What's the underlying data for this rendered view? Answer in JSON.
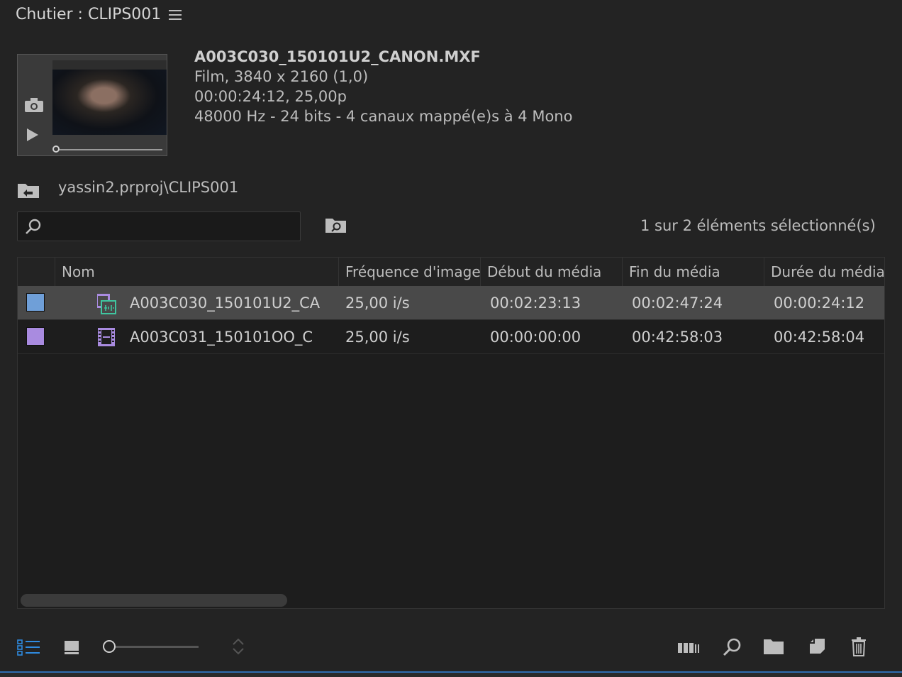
{
  "panel": {
    "title": "Chutier : CLIPS001"
  },
  "preview": {
    "file_name": "A003C030_150101U2_CANON.MXF",
    "line1": "Film, 3840 x 2160 (1,0)",
    "line2": "00:00:24:12, 25,00p",
    "line3": "48000 Hz - 24 bits - 4 canaux mappé(e)s à 4 Mono"
  },
  "path": {
    "text": "yassin2.prproj\\CLIPS001"
  },
  "search": {
    "value": "",
    "placeholder": ""
  },
  "selection": {
    "count_text": "1 sur 2 éléments sélectionné(s)"
  },
  "table": {
    "columns": [
      "Nom",
      "Fréquence d'images",
      "Début du média",
      "Fin du média",
      "Durée du média"
    ],
    "rows": [
      {
        "label_color": "#6f9fd8",
        "name": "A003C030_150101U2_CA",
        "rate": "25,00 i/s",
        "start": "00:02:23:13",
        "end": "00:02:47:24",
        "duration": "00:00:24:12",
        "selected": true,
        "icon": "video-audio-clip-icon"
      },
      {
        "label_color": "#a98be0",
        "name": "A003C031_150101OO_C",
        "rate": "25,00 i/s",
        "start": "00:00:00:00",
        "end": "00:42:58:03",
        "duration": "00:42:58:04",
        "selected": false,
        "icon": "video-clip-icon"
      }
    ]
  },
  "footer": {
    "icons": [
      "list-view-icon",
      "icon-view-icon",
      "zoom-slider",
      "sort-icon",
      "automate-to-sequence-icon",
      "find-icon",
      "new-bin-icon",
      "new-item-icon",
      "trash-icon"
    ]
  },
  "colors": {
    "background": "#232323",
    "selected_row": "#494949",
    "accent": "#2f6db0",
    "clip_purple": "#a98be0",
    "clip_green": "#3fc6a0"
  }
}
